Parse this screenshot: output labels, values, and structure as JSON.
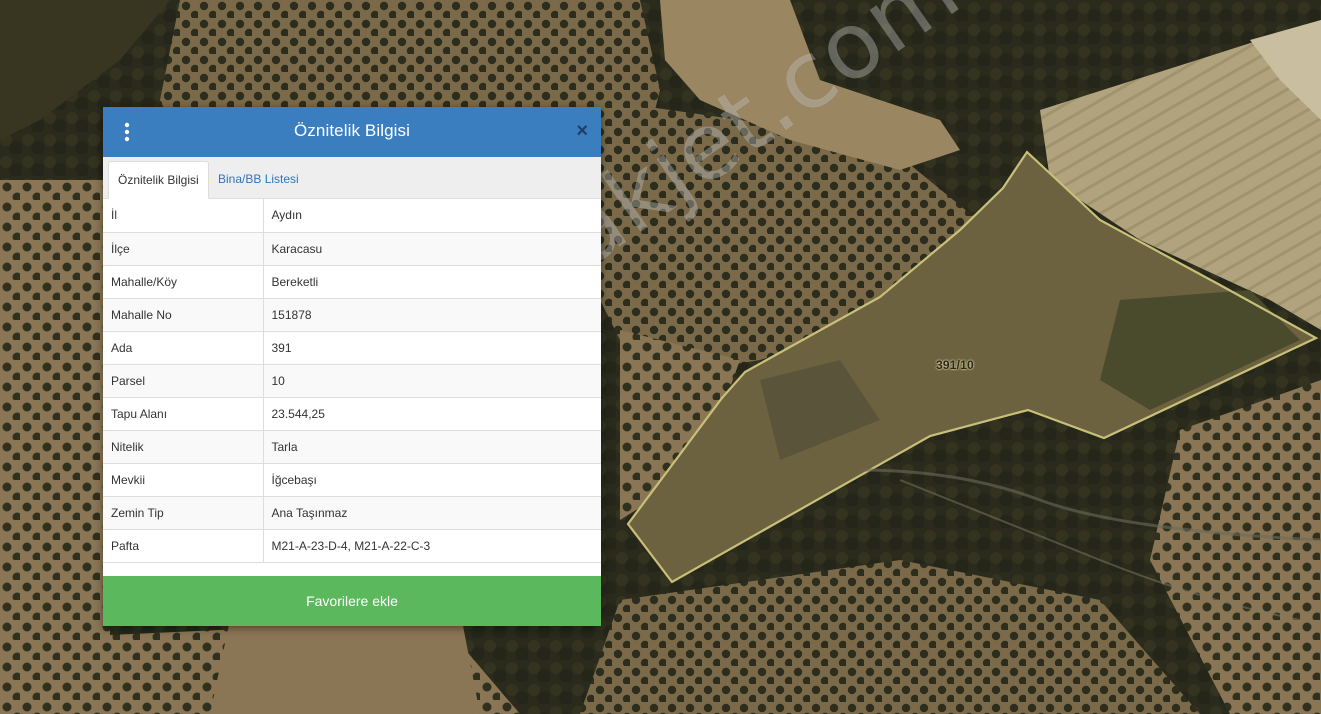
{
  "panel": {
    "title": "Öznitelik Bilgisi",
    "close_label": "×",
    "tabs": [
      {
        "label": "Öznitelik Bilgisi",
        "active": true
      },
      {
        "label": "Bina/BB Listesi",
        "active": false
      }
    ],
    "rows": [
      {
        "key": "İl",
        "value": "Aydın"
      },
      {
        "key": "İlçe",
        "value": "Karacasu"
      },
      {
        "key": "Mahalle/Köy",
        "value": "Bereketli"
      },
      {
        "key": "Mahalle No",
        "value": "151878"
      },
      {
        "key": "Ada",
        "value": "391"
      },
      {
        "key": "Parsel",
        "value": "10"
      },
      {
        "key": "Tapu Alanı",
        "value": "23.544,25"
      },
      {
        "key": "Nitelik",
        "value": "Tarla"
      },
      {
        "key": "Mevkii",
        "value": "İğcebaşı"
      },
      {
        "key": "Zemin Tip",
        "value": "Ana Taşınmaz"
      },
      {
        "key": "Pafta",
        "value": "M21-A-23-D-4, M21-A-22-C-3"
      }
    ],
    "favorite_button": "Favorilere ekle"
  },
  "map": {
    "parcel_label": "391/10",
    "watermark": "emlakjet.com"
  },
  "colors": {
    "header": "#3a7ec0",
    "button": "#5cb85c",
    "tab_link": "#2f76b8",
    "parcel_outline": "#c8c07a"
  },
  "icons": {
    "menu": "vertical-ellipsis-icon",
    "close": "close-icon"
  }
}
